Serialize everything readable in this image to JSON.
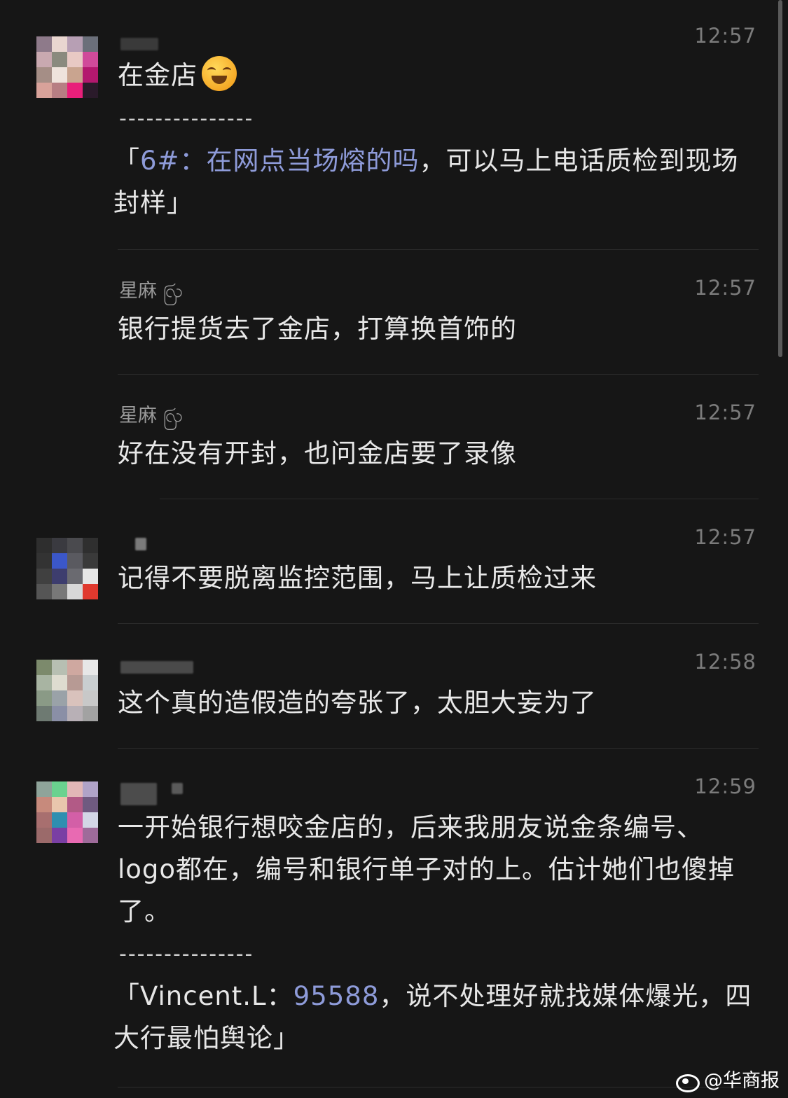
{
  "messages": [
    {
      "time": "12:57",
      "text": "在金店",
      "emoji": "laughing-crying-emoji",
      "dashes": "---------------",
      "quote_open": "「",
      "quote_author": "6#：在网点当场熔的吗",
      "quote_rest": "，可以马上电话质检到现场封样」"
    },
    {
      "name": "星麻",
      "name_suffix": "ꩺ",
      "time": "12:57",
      "text": "银行提货去了金店，打算换首饰的"
    },
    {
      "name": "星麻",
      "name_suffix": "ꩺ",
      "time": "12:57",
      "text": "好在没有开封，也问金店要了录像"
    },
    {
      "time": "12:57",
      "text": "记得不要脱离监控范围，马上让质检过来"
    },
    {
      "time": "12:58",
      "text": "这个真的造假造的夸张了，太胆大妄为了"
    },
    {
      "time": "12:59",
      "text": "一开始银行想咬金店的，后来我朋友说金条编号、logo都在，编号和银行单子对的上。估计她们也傻掉了。",
      "dashes": "---------------",
      "quote_open": "「",
      "quote_author": "Vincent.L：",
      "quote_highlight": "95588",
      "quote_rest": "，说不处理好就找媒体爆光，四大行最怕舆论」"
    }
  ],
  "watermark": {
    "icon": "weibo-icon",
    "text": "@华商报"
  }
}
